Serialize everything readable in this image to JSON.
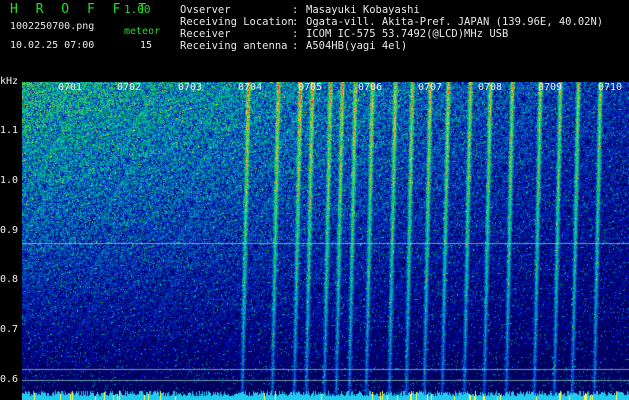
{
  "app": {
    "title": "H R O F F T",
    "version": "1.00",
    "filename": "1002250700.png",
    "datetime": "10.02.25 07:00",
    "meteor_label": "meteor",
    "meteor_count": "15"
  },
  "info": {
    "rows": [
      {
        "label": "Ovserver",
        "sep": ":",
        "value": "Masayuki Kobayashi"
      },
      {
        "label": "Receiving Location",
        "sep": ":",
        "value": "Ogata-vill. Akita-Pref. JAPAN (139.96E, 40.02N)"
      },
      {
        "label": "Receiver",
        "sep": ":",
        "value": "ICOM IC-575 53.7492(@LCD)MHz USB"
      },
      {
        "label": "Receiving antenna",
        "sep": ":",
        "value": "A504HB(yagi 4el)"
      }
    ]
  },
  "spectrogram": {
    "y_unit": "kHz",
    "y_ticks": [
      "1.1",
      "1.0",
      "0.9",
      "0.8",
      "0.7",
      "0.6"
    ],
    "x_ticks": [
      "0701",
      "0702",
      "0703",
      "0704",
      "0705",
      "0706",
      "0707",
      "0708",
      "0709",
      "0710"
    ]
  },
  "colors": {
    "header_green": "#22dd22",
    "header_text": "#e8e8e8",
    "background": "#000000"
  }
}
